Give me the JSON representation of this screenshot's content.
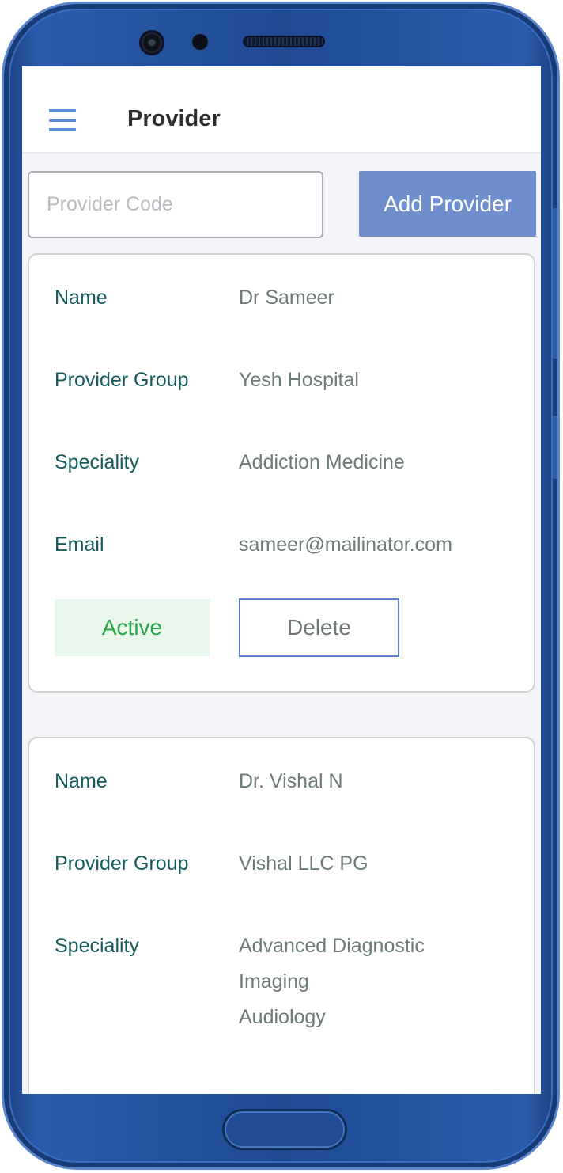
{
  "header": {
    "title": "Provider"
  },
  "search": {
    "placeholder": "Provider Code",
    "value": ""
  },
  "toolbar": {
    "add_label": "Add Provider"
  },
  "providers": [
    {
      "name_label": "Name",
      "name": "Dr Sameer",
      "group_label": "Provider Group",
      "group": "Yesh Hospital",
      "speciality_label": "Speciality",
      "speciality": [
        "Addiction Medicine"
      ],
      "email_label": "Email",
      "email": "sameer@mailinator.com",
      "status": "Active",
      "delete_label": "Delete"
    },
    {
      "name_label": "Name",
      "name": "Dr. Vishal N",
      "group_label": "Provider Group",
      "group": "Vishal LLC PG",
      "speciality_label": "Speciality",
      "speciality": [
        "Advanced Diagnostic",
        "Imaging",
        "Audiology"
      ]
    }
  ],
  "colors": {
    "accent": "#6f8fcc",
    "label_text": "#165b5b",
    "value_text": "#6c7a7a",
    "active_bg": "#e8f6ec",
    "active_text": "#2aa548",
    "phone_body": "#1e4a92"
  },
  "icons": {
    "menu": "hamburger-menu-icon"
  }
}
